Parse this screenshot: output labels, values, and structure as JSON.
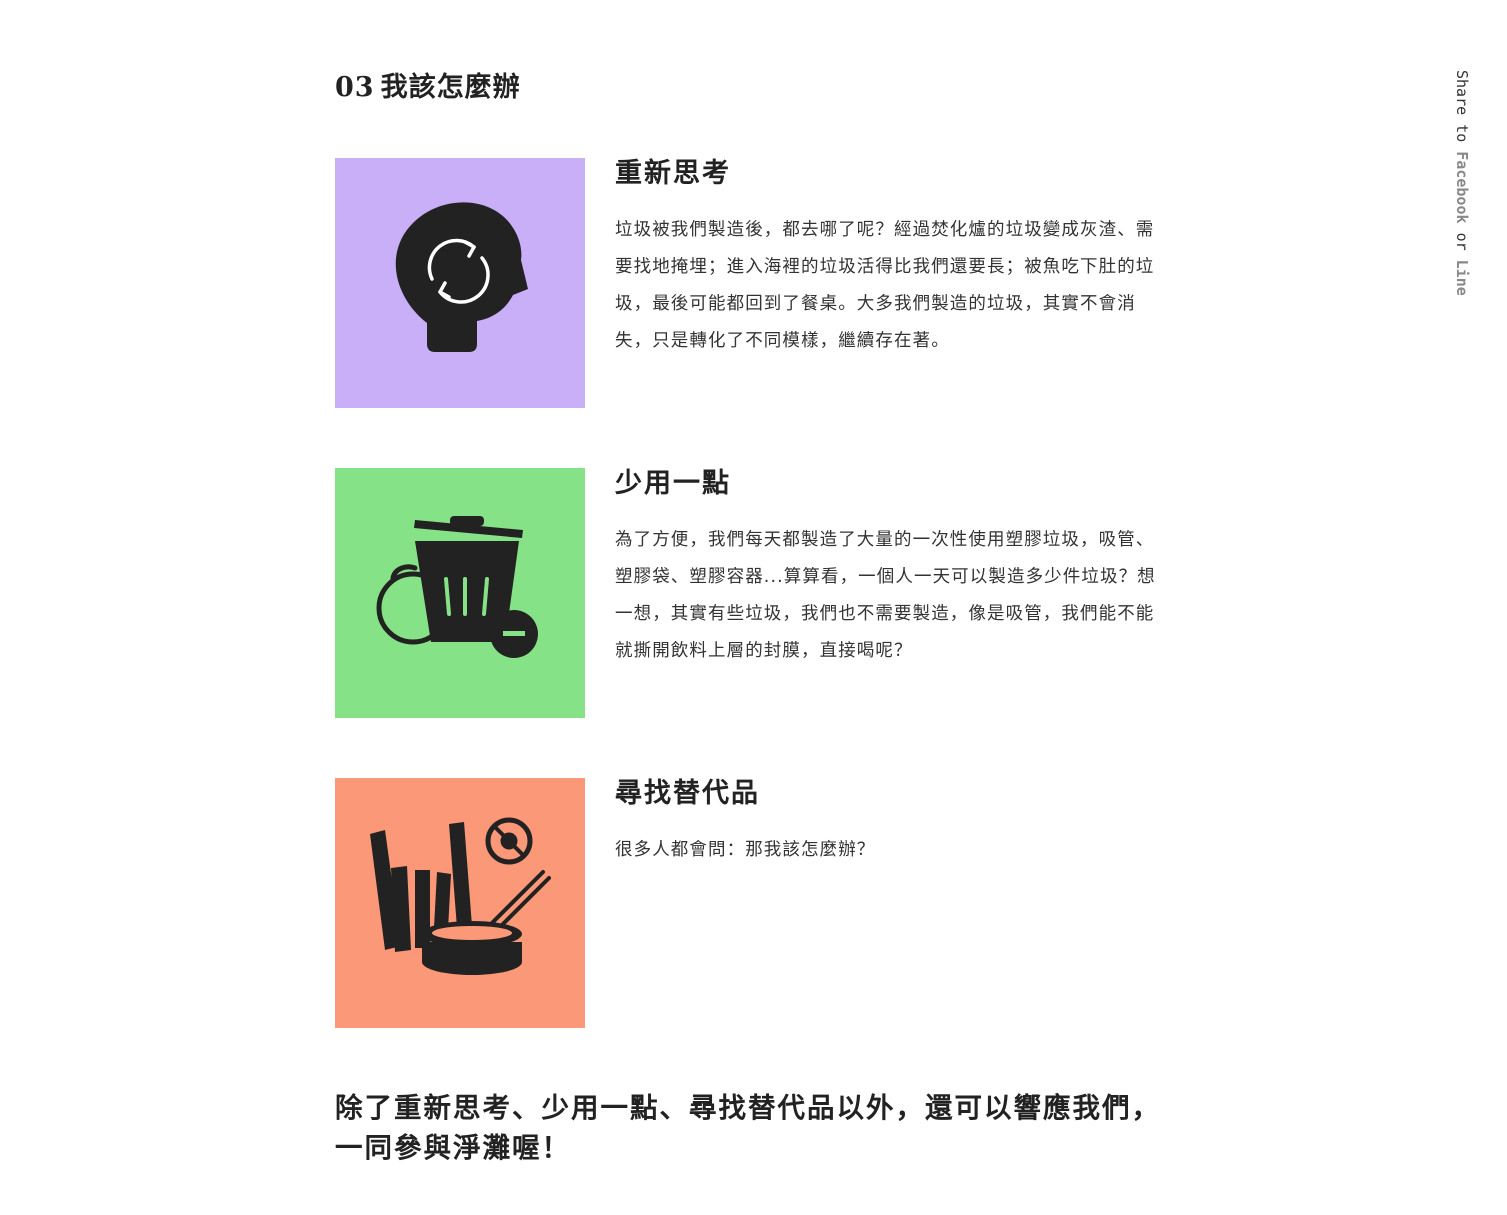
{
  "section": {
    "number": "03",
    "title": "我該怎麼辦"
  },
  "items": [
    {
      "heading": "重新思考",
      "body": "垃圾被我們製造後，都去哪了呢？經過焚化爐的垃圾變成灰渣、需要找地掩埋；進入海裡的垃圾活得比我們還要長；被魚吃下肚的垃圾，最後可能都回到了餐桌。大多我們製造的垃圾，其實不會消失，只是轉化了不同模樣，繼續存在著。",
      "icon": "rethink-head-icon",
      "color": "#c8aff7"
    },
    {
      "heading": "少用一點",
      "body": "為了方便，我們每天都製造了大量的一次性使用塑膠垃圾，吸管、塑膠袋、塑膠容器...算算看，一個人一天可以製造多少件垃圾？想一想，其實有些垃圾，我們也不需要製造，像是吸管，我們能不能就撕開飲料上層的封膜，直接喝呢？",
      "icon": "trash-can-icon",
      "color": "#86e286"
    },
    {
      "heading": "尋找替代品",
      "body": "很多人都會問：那我該怎麼辦？",
      "icon": "reusable-items-icon",
      "color": "#fa9878"
    }
  ],
  "closing": "除了重新思考、少用一點、尋找替代品以外，還可以響應我們，一同參與淨灘喔！",
  "share": {
    "prefix": "Share to",
    "facebook": "Facebook",
    "or": "or",
    "line": "Line"
  }
}
